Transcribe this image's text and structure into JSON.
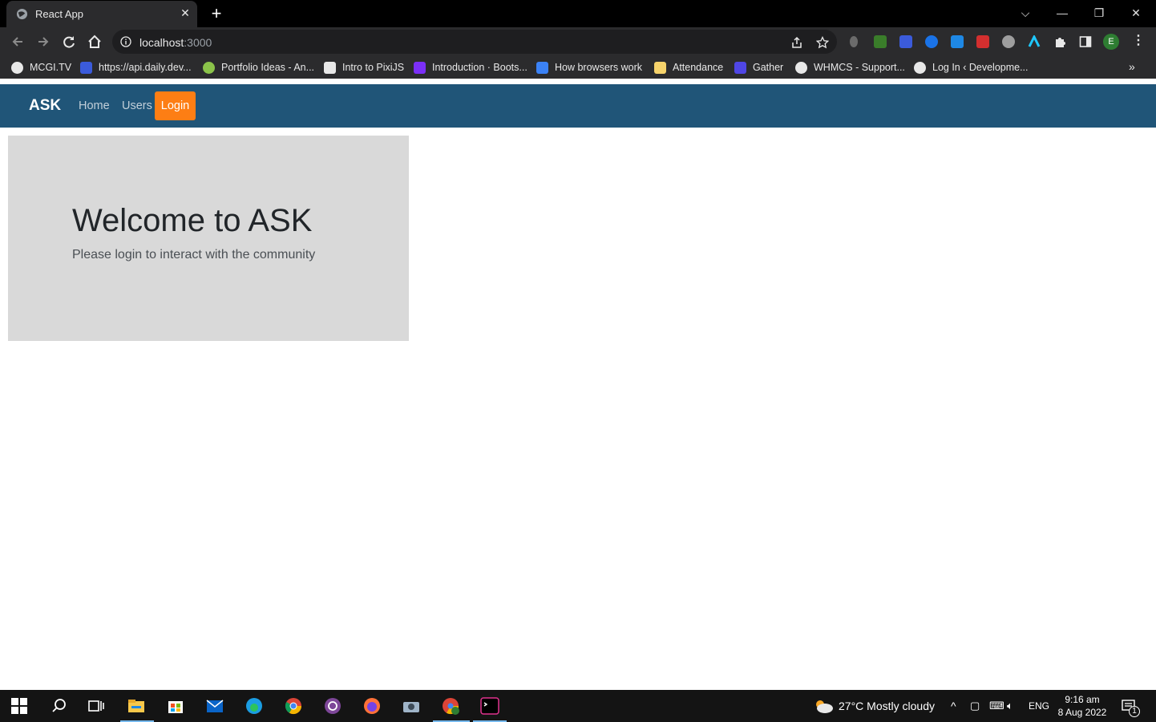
{
  "browser": {
    "tab_title": "React App",
    "url_host": "localhost",
    "url_port": ":3000",
    "bookmarks": [
      {
        "label": "MCGI.TV",
        "icon": "globe-icon",
        "color": "#e8e8e8"
      },
      {
        "label": "https://api.daily.dev...",
        "icon": "daily-dev-icon",
        "color": "#3b5bdb"
      },
      {
        "label": "Portfolio Ideas - An...",
        "icon": "portfolio-icon",
        "color": "#8bc34a"
      },
      {
        "label": "Intro to PixiJS",
        "icon": "pixijs-icon",
        "color": "#e8e8e8"
      },
      {
        "label": "Introduction · Boots...",
        "icon": "bootstrap-icon",
        "color": "#7b2ff7"
      },
      {
        "label": "How browsers work",
        "icon": "browser-dev-icon",
        "color": "#3b82f6"
      },
      {
        "label": "Attendance",
        "icon": "folder-icon",
        "color": "#f6d36b"
      },
      {
        "label": "Gather",
        "icon": "gather-icon",
        "color": "#4f46e5"
      },
      {
        "label": "WHMCS - Support...",
        "icon": "globe-icon",
        "color": "#e8e8e8"
      },
      {
        "label": "Log In ‹ Developme...",
        "icon": "wordpress-icon",
        "color": "#e8e8e8"
      }
    ],
    "profile_initial": "E"
  },
  "app": {
    "brand": "ASK",
    "nav": {
      "home": "Home",
      "users": "Users",
      "login": "Login"
    },
    "hero": {
      "title": "Welcome to ASK",
      "subtitle": "Please login to interact with the community"
    },
    "colors": {
      "navbar": "#205578",
      "login_button": "#fd7e14",
      "hero_bg": "#d9d9d9"
    }
  },
  "taskbar": {
    "weather": "27°C  Mostly cloudy",
    "language": "ENG",
    "time": "9:16 am",
    "date": "8 Aug 2022",
    "notifications": "1"
  }
}
